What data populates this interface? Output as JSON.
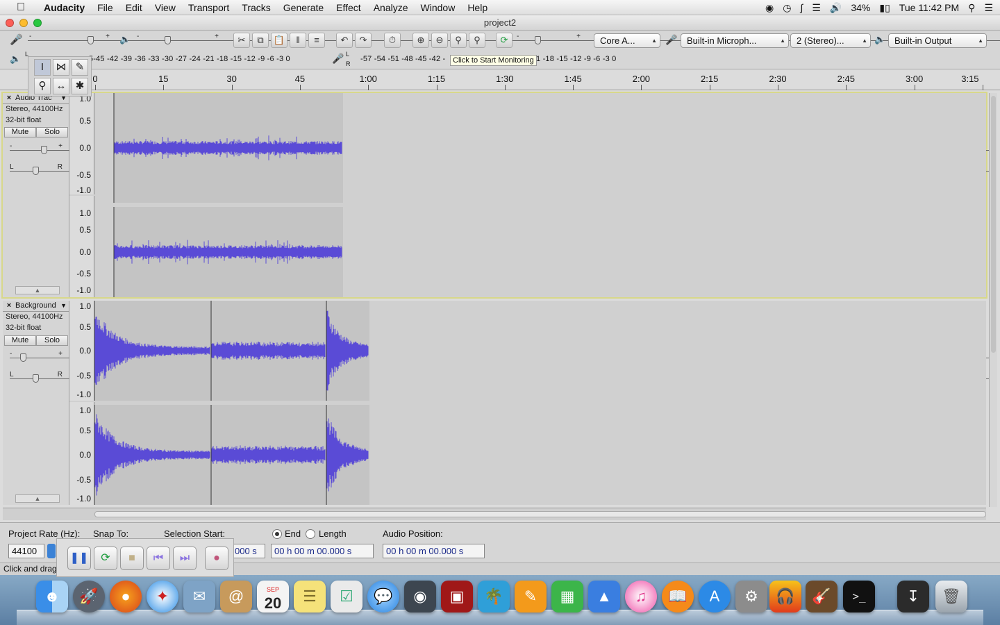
{
  "menubar": {
    "apple_icon": "apple-logo-icon",
    "items": [
      "Audacity",
      "File",
      "Edit",
      "View",
      "Transport",
      "Tracks",
      "Generate",
      "Effect",
      "Analyze",
      "Window",
      "Help"
    ],
    "battery": "34%",
    "clock": "Tue 11:42 PM"
  },
  "window": {
    "title": "project2"
  },
  "toolbar": {
    "audio_host": "Core A...",
    "input_device": "Built-in Microph...",
    "channels": "2 (Stereo)...",
    "output_device": "Built-in Output",
    "playback_meter_scale": "-45 -42 -39 -36 -33 -30 -27 -24 -21 -18 -15 -12 -9 -6 -3 0",
    "playback_meter_prefix": "-5",
    "record_meter_scale": "-57 -54 -51 -48 -45 -42 -",
    "record_meter_suffix": "1 -18 -15 -12 -9 -6 -3 0",
    "record_meter_tooltip": "Click to Start Monitoring",
    "slider_minus": "-",
    "slider_plus": "+",
    "meter_L": "L",
    "meter_R": "R"
  },
  "ruler": {
    "labels": [
      "0",
      "15",
      "30",
      "45",
      "1:00",
      "1:15",
      "1:30",
      "1:45",
      "2:00",
      "2:15",
      "2:30",
      "2:45",
      "3:00",
      "3:15"
    ]
  },
  "tracks": [
    {
      "name": "Audio Trac",
      "format": "Stereo, 44100Hz",
      "bits": "32-bit float",
      "mute": "Mute",
      "solo": "Solo",
      "gain_minus": "-",
      "gain_plus": "+",
      "pan_left": "L",
      "pan_right": "R",
      "scale": [
        "1.0",
        "0.5",
        "0.0",
        "-0.5",
        "-1.0"
      ]
    },
    {
      "name": "Background",
      "format": "Stereo, 44100Hz",
      "bits": "32-bit float",
      "mute": "Mute",
      "solo": "Solo",
      "gain_minus": "-",
      "gain_plus": "+",
      "pan_left": "L",
      "pan_right": "R",
      "scale": [
        "1.0",
        "0.5",
        "0.0",
        "-0.5",
        "-1.0"
      ]
    }
  ],
  "selection": {
    "project_rate_label": "Project Rate (Hz):",
    "project_rate_value": "44100",
    "snap_to_label": "Snap To:",
    "selection_start_label": "Selection Start:",
    "selection_start_value": "000 s",
    "end_label": "End",
    "length_label": "Length",
    "end_value": "00 h 00 m 00.000 s",
    "audio_position_label": "Audio Position:",
    "audio_position_value": "00 h 00 m 00.000 s"
  },
  "status": {
    "text": "Click and drag"
  },
  "colors": {
    "waveform": "#5a4bd6",
    "clip_bg": "#c4c4c4",
    "track_bg": "#d0d0d0",
    "selected_outline": "#d8d88a"
  },
  "dock": {
    "calendar_month": "SEP",
    "calendar_day": "20",
    "icons": [
      "finder-icon",
      "launchpad-icon",
      "firefox-icon",
      "safari-icon",
      "mail-icon",
      "contacts-icon",
      "calendar-icon",
      "notes-icon",
      "reminders-icon",
      "messages-icon",
      "facetime-icon",
      "photo-booth-icon",
      "iphoto-icon",
      "pages-icon",
      "numbers-icon",
      "keynote-icon",
      "itunes-icon",
      "ibooks-icon",
      "app-store-icon",
      "system-preferences-icon",
      "audacity-icon",
      "garageband-icon",
      "terminal-icon",
      "downloads-icon",
      "trash-icon"
    ]
  }
}
